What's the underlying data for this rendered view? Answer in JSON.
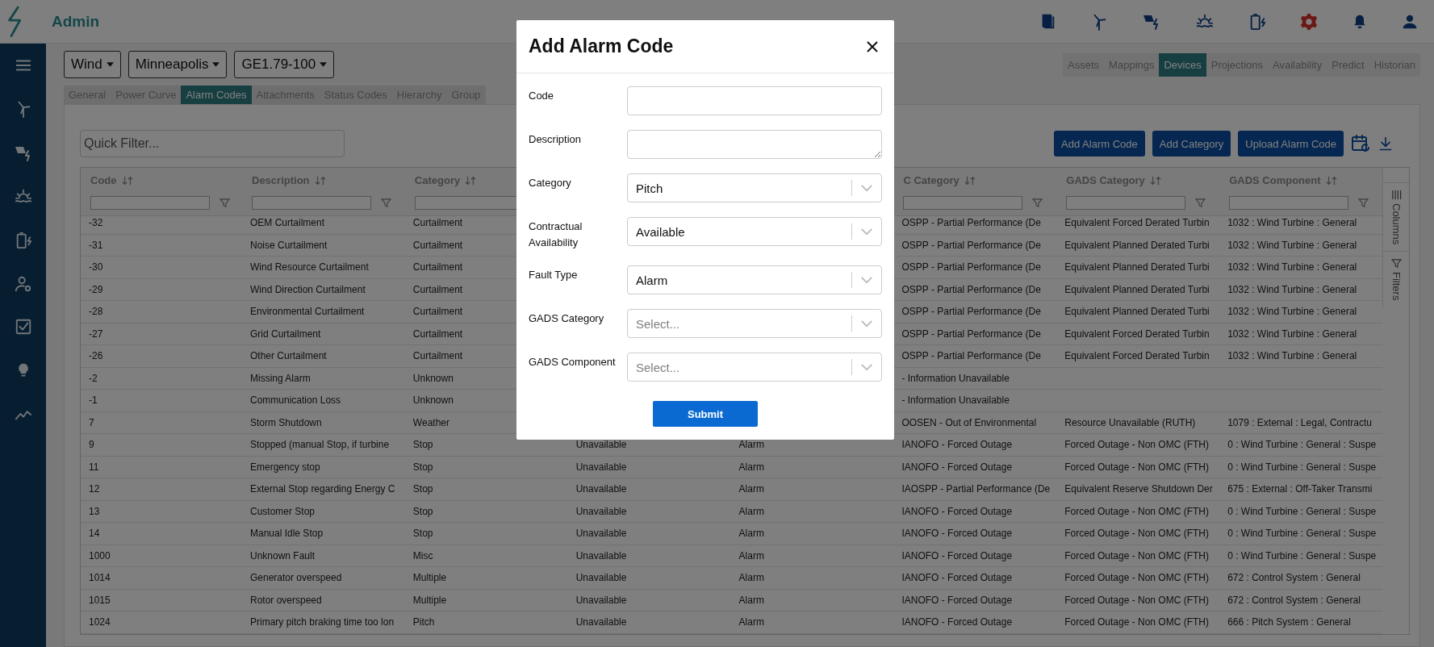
{
  "app": {
    "title": "Admin"
  },
  "selectors": [
    "Wind",
    "Minneapolis",
    "GE1.79-100"
  ],
  "nav_tabs": [
    {
      "label": "Assets",
      "selected": false
    },
    {
      "label": "Mappings",
      "selected": false
    },
    {
      "label": "Devices",
      "selected": true
    },
    {
      "label": "Projections",
      "selected": false
    },
    {
      "label": "Availability",
      "selected": false
    },
    {
      "label": "Predict",
      "selected": false
    },
    {
      "label": "Historian",
      "selected": false
    }
  ],
  "sub_tabs": [
    {
      "label": "General",
      "selected": false
    },
    {
      "label": "Power Curve",
      "selected": false
    },
    {
      "label": "Alarm Codes",
      "selected": true
    },
    {
      "label": "Attachments",
      "selected": false
    },
    {
      "label": "Status Codes",
      "selected": false
    },
    {
      "label": "Hierarchy",
      "selected": false
    },
    {
      "label": "Group",
      "selected": false
    }
  ],
  "quick_filter": {
    "placeholder": "Quick Filter..."
  },
  "actions": [
    "Add Alarm Code",
    "Add Category",
    "Upload Alarm Code"
  ],
  "table": {
    "columns": [
      "Code",
      "Description",
      "Category",
      null,
      null,
      "C Category",
      "GADS Category",
      "GADS Component"
    ],
    "rows": [
      [
        "-32",
        "OEM Curtailment",
        "Curtailment",
        null,
        null,
        "OSPP - Partial Performance (De",
        "Equivalent Forced Derated Turbin",
        "1032 : Wind Turbine : General"
      ],
      [
        "-31",
        "Noise Curtailment",
        "Curtailment",
        null,
        null,
        "OSPP - Partial Performance (De",
        "Equivalent Planned Derated Turbi",
        "1032 : Wind Turbine : General"
      ],
      [
        "-30",
        "Wind Resource Curtailment",
        "Curtailment",
        null,
        null,
        "OSPP - Partial Performance (De",
        "Equivalent Planned Derated Turbi",
        "1032 : Wind Turbine : General"
      ],
      [
        "-29",
        "Wind Direction Curtailment",
        "Curtailment",
        null,
        null,
        "OSPP - Partial Performance (De",
        "Equivalent Planned Derated Turbi",
        "1032 : Wind Turbine : General"
      ],
      [
        "-28",
        "Environmental Curtailment",
        "Curtailment",
        null,
        null,
        "OSPP - Partial Performance (De",
        "Equivalent Planned Derated Turbi",
        "1032 : Wind Turbine : General"
      ],
      [
        "-27",
        "Grid Curtailment",
        "Curtailment",
        null,
        null,
        "OSPP - Partial Performance (De",
        "Equivalent Forced Derated Turbin",
        "1032 : Wind Turbine : General"
      ],
      [
        "-26",
        "Other Curtailment",
        "Curtailment",
        null,
        null,
        "OSPP - Partial Performance (De",
        "Equivalent Forced Derated Turbin",
        "1032 : Wind Turbine : General"
      ],
      [
        "-2",
        "Missing Alarm",
        "Unknown",
        null,
        null,
        "- Information Unavailable",
        null,
        null
      ],
      [
        "-1",
        "Communication Loss",
        "Unknown",
        null,
        null,
        "- Information Unavailable",
        null,
        null
      ],
      [
        "7",
        "Storm Shutdown",
        "Weather",
        null,
        null,
        "OOSEN - Out of Environmental",
        "Resource Unavailable (RUTH)",
        "1079 : External : Legal, Contractu"
      ],
      [
        "9",
        "Stopped (manual Stop, if turbine",
        "Stop",
        "Unavailable",
        "Alarm",
        "IANOFO - Forced Outage",
        "Forced Outage - Non OMC (FTH)",
        "0 : Wind Turbine : General : Suspe"
      ],
      [
        "11",
        "Emergency stop",
        "Stop",
        "Unavailable",
        "Alarm",
        "IANOFO - Forced Outage",
        "Forced Outage - Non OMC (FTH)",
        "0 : Wind Turbine : General : Suspe"
      ],
      [
        "12",
        "External Stop regarding Energy C",
        "Stop",
        "Unavailable",
        "Alarm",
        "IAOSPP - Partial Performance (De",
        "Equivalent Reserve Shutdown Der",
        "675 : External : Off-Taker Transmi"
      ],
      [
        "13",
        "Customer Stop",
        "Stop",
        "Unavailable",
        "Alarm",
        "IANOFO - Forced Outage",
        "Forced Outage - Non OMC (FTH)",
        "0 : Wind Turbine : General : Suspe"
      ],
      [
        "14",
        "Manual Idle Stop",
        "Stop",
        "Unavailable",
        "Alarm",
        "IANOFO - Forced Outage",
        "Forced Outage - Non OMC (FTH)",
        "0 : Wind Turbine : General : Suspe"
      ],
      [
        "1000",
        "Unknown Fault",
        "Misc",
        "Unavailable",
        "Alarm",
        "IANOFO - Forced Outage",
        "Forced Outage - Non OMC (FTH)",
        "0 : Wind Turbine : General : Suspe"
      ],
      [
        "1014",
        "Generator overspeed",
        "Multiple",
        "Unavailable",
        "Alarm",
        "IANOFO - Forced Outage",
        "Forced Outage - Non OMC (FTH)",
        "672 : Control System : General"
      ],
      [
        "1015",
        "Rotor overspeed",
        "Multiple",
        "Unavailable",
        "Alarm",
        "IANOFO - Forced Outage",
        "Forced Outage - Non OMC (FTH)",
        "672 : Control System : General"
      ],
      [
        "1024",
        "Primary pitch braking time too lon",
        "Pitch",
        "Unavailable",
        "Alarm",
        "IANOFO - Forced Outage",
        "Forced Outage - Non OMC (FTH)",
        "666 : Pitch System : General"
      ]
    ]
  },
  "side_panel": [
    "Columns",
    "Filters"
  ],
  "modal": {
    "title": "Add Alarm Code",
    "fields": [
      {
        "label": "Code",
        "kind": "text"
      },
      {
        "label": "Description",
        "kind": "textarea"
      },
      {
        "label": "Category",
        "kind": "select",
        "value": "Pitch"
      },
      {
        "label": "Contractual Availability",
        "kind": "select",
        "value": "Available"
      },
      {
        "label": "Fault Type",
        "kind": "select",
        "value": "Alarm"
      },
      {
        "label": "GADS Category",
        "kind": "select",
        "placeholder": "Select..."
      },
      {
        "label": "GADS Component",
        "kind": "select",
        "placeholder": "Select..."
      }
    ],
    "submit": "Submit"
  }
}
